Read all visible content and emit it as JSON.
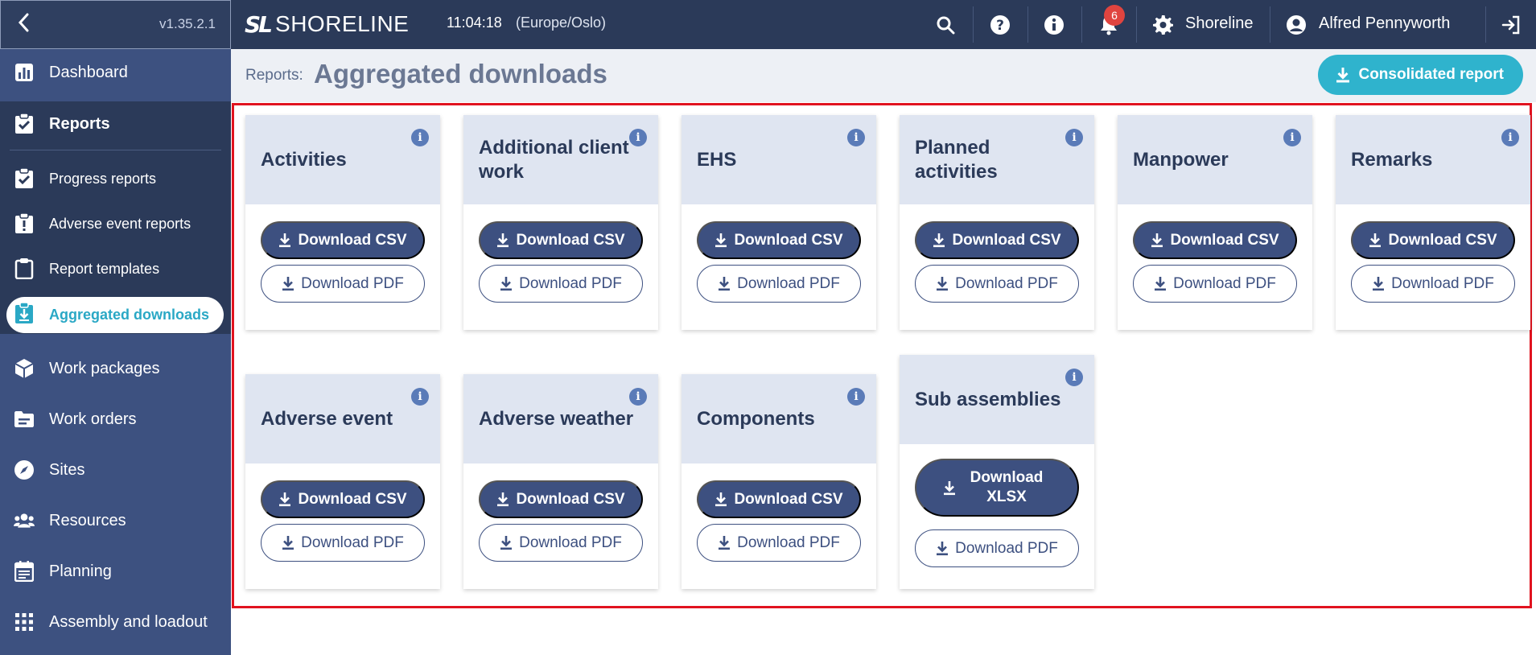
{
  "app": {
    "version": "v1.35.2.1",
    "logo_mark": "SL",
    "logo_text": "SHORELINE",
    "time": "11:04:18",
    "timezone": "(Europe/Oslo)",
    "notifications_count": "6",
    "org_name": "Shoreline",
    "user_name": "Alfred Pennyworth",
    "colors": {
      "topbar": "#2b3a59",
      "sidebar": "#3d5180",
      "accent": "#2fb3cd",
      "primary_button": "#3d5080",
      "card_header": "#dfe5f1"
    }
  },
  "sidebar": {
    "items": [
      {
        "label": "Dashboard",
        "icon": "bar-chart-icon"
      },
      {
        "label": "Reports",
        "icon": "clipboard-check-icon"
      },
      {
        "label": "Progress reports",
        "icon": "clipboard-check-icon"
      },
      {
        "label": "Adverse event reports",
        "icon": "clipboard-alert-icon"
      },
      {
        "label": "Report templates",
        "icon": "clipboard-icon"
      },
      {
        "label": "Aggregated downloads",
        "icon": "clipboard-download-icon"
      },
      {
        "label": "Work packages",
        "icon": "cube-icon"
      },
      {
        "label": "Work orders",
        "icon": "folder-icon"
      },
      {
        "label": "Sites",
        "icon": "compass-icon"
      },
      {
        "label": "Resources",
        "icon": "people-icon"
      },
      {
        "label": "Planning",
        "icon": "calendar-icon"
      },
      {
        "label": "Assembly and loadout",
        "icon": "grid-icon"
      }
    ]
  },
  "header": {
    "breadcrumb": "Reports:",
    "title": "Aggregated downloads",
    "consolidated_label": "Consolidated report"
  },
  "cards": [
    {
      "title": "Activities",
      "primary": "Download CSV",
      "secondary": "Download PDF"
    },
    {
      "title": "Additional client work",
      "primary": "Download CSV",
      "secondary": "Download PDF"
    },
    {
      "title": "EHS",
      "primary": "Download CSV",
      "secondary": "Download PDF"
    },
    {
      "title": "Planned activities",
      "primary": "Download CSV",
      "secondary": "Download PDF"
    },
    {
      "title": "Manpower",
      "primary": "Download CSV",
      "secondary": "Download PDF"
    },
    {
      "title": "Remarks",
      "primary": "Download CSV",
      "secondary": "Download PDF"
    },
    {
      "title": "Adverse event",
      "primary": "Download CSV",
      "secondary": "Download PDF"
    },
    {
      "title": "Adverse weather",
      "primary": "Download CSV",
      "secondary": "Download PDF"
    },
    {
      "title": "Components",
      "primary": "Download CSV",
      "secondary": "Download PDF"
    },
    {
      "title": "Sub assemblies",
      "primary": "Download XLSX",
      "secondary": "Download PDF"
    }
  ]
}
